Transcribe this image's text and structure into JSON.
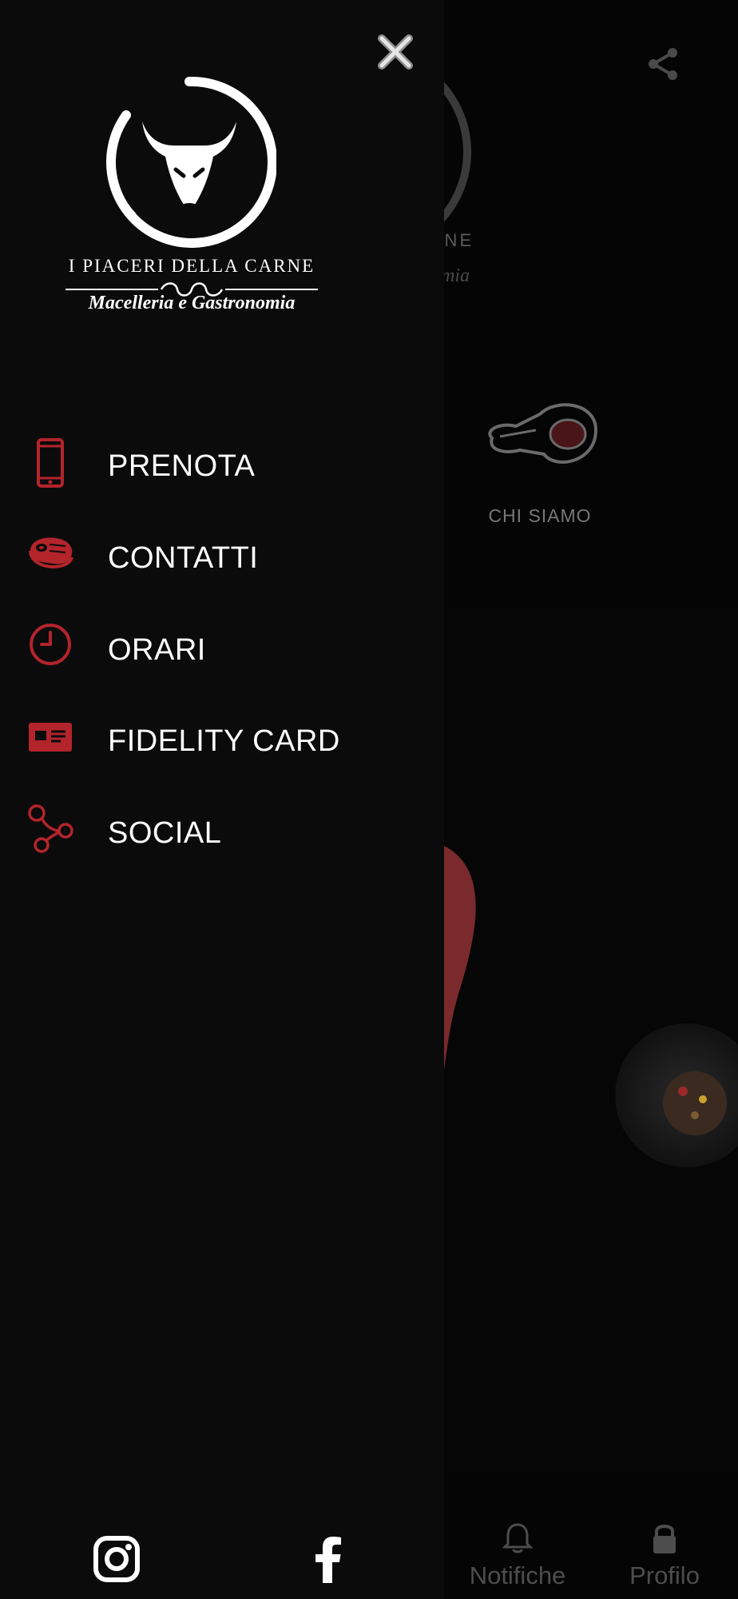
{
  "background_app": {
    "brand_partial_name": "ARNE",
    "brand_partial_tagline": "omia",
    "tile_label": "CHI SIAMO",
    "tabs": [
      {
        "label": "Notifiche",
        "icon": "bell-icon"
      },
      {
        "label": "Profilo",
        "icon": "lock-icon"
      }
    ]
  },
  "drawer": {
    "brand": {
      "name": "I PIACERI DELLA CARNE",
      "tagline": "Macelleria e Gastronomia"
    },
    "menu": [
      {
        "label": "PRENOTA",
        "icon": "smartphone-icon"
      },
      {
        "label": "CONTATTI",
        "icon": "steak-icon"
      },
      {
        "label": "ORARI",
        "icon": "clock-icon"
      },
      {
        "label": "FIDELITY CARD",
        "icon": "id-card-icon"
      },
      {
        "label": "SOCIAL",
        "icon": "nodes-icon"
      }
    ],
    "social": [
      {
        "icon": "instagram-icon"
      },
      {
        "icon": "facebook-icon"
      }
    ]
  },
  "colors": {
    "accent": "#b3242b",
    "drawer_bg": "#0b0b0c",
    "text": "#ffffff",
    "dim_text": "#4d4d4d"
  }
}
